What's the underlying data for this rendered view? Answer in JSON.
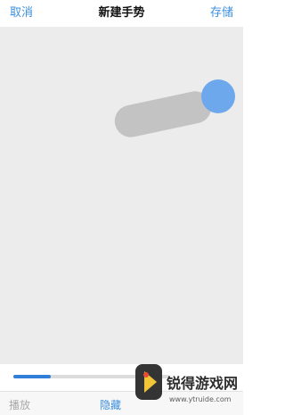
{
  "nav": {
    "cancel_label": "取消",
    "title": "新建手势",
    "save_label": "存储"
  },
  "progress": {
    "value": 0.24
  },
  "toolbar": {
    "play_label": "播放",
    "hide_label": "隐藏"
  },
  "colors": {
    "accent": "#3b8fe0",
    "touch_dot": "#6ea8ec",
    "stroke": "#c3c3c3",
    "canvas": "#ececec"
  },
  "watermark": {
    "brand_text": "锐得游戏网",
    "url_text": "www.ytruide.com"
  }
}
